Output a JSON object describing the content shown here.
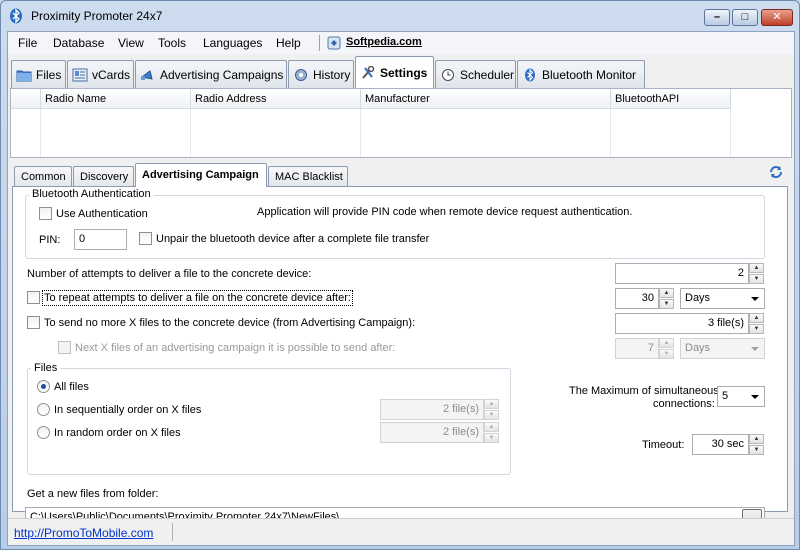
{
  "window": {
    "title": "Proximity Promoter 24x7",
    "controls": {
      "minimize": "–",
      "maximize": "□",
      "close": "✕"
    }
  },
  "menu": {
    "items": [
      "File",
      "Database",
      "View",
      "Tools",
      "Languages",
      "Help"
    ],
    "softpedia_link": "Softpedia.com"
  },
  "main_tabs": [
    {
      "label": "Files",
      "icon": "folder-icon"
    },
    {
      "label": "vCards",
      "icon": "vcard-icon"
    },
    {
      "label": "Advertising Campaigns",
      "icon": "campaign-icon"
    },
    {
      "label": "History",
      "icon": "history-gear-icon"
    },
    {
      "label": "Settings",
      "icon": "settings-tools-icon",
      "active": true
    },
    {
      "label": "Scheduler",
      "icon": "clock-icon"
    },
    {
      "label": "Bluetooth Monitor",
      "icon": "bluetooth-icon"
    }
  ],
  "radio_grid": {
    "columns": [
      "Radio Name",
      "Radio Address",
      "Manufacturer",
      "BluetoothAPI"
    ]
  },
  "sub_tabs": [
    "Common",
    "Discovery",
    "Advertising Campaign",
    "MAC Blacklist"
  ],
  "active_sub_tab": "Advertising Campaign",
  "auth": {
    "group_title": "Bluetooth Authentication",
    "use_auth_label": "Use Authentication",
    "use_auth_checked": false,
    "info": "Application will provide PIN code when remote device request authentication.",
    "pin_label": "PIN:",
    "pin_value": "0",
    "unpair_label": "Unpair the bluetooth device after a complete file transfer",
    "unpair_checked": false
  },
  "attempts": {
    "label": "Number of attempts to deliver a file to the concrete device:",
    "value": "2"
  },
  "repeat": {
    "label": "To repeat attempts to deliver a file on the concrete device after:",
    "checked": false,
    "value": "30",
    "unit": "Days"
  },
  "max_files": {
    "label": "To send no more X files to the concrete device (from Advertising Campaign):",
    "checked": false,
    "value": "3 file(s)"
  },
  "next_files": {
    "label": "Next X files of an advertising campaign it is possible to send after:",
    "checked": false,
    "value": "7",
    "unit": "Days"
  },
  "files_group": {
    "title": "Files",
    "options": [
      {
        "label": "All files",
        "selected": true
      },
      {
        "label": "In sequentially order on X files",
        "selected": false,
        "value": "2 file(s)"
      },
      {
        "label": "In random order on X files",
        "selected": false,
        "value": "2 file(s)"
      }
    ]
  },
  "connections": {
    "label_line1": "The Maximum of simultaneous",
    "label_line2": "connections:",
    "value": "5"
  },
  "timeout": {
    "label": "Timeout:",
    "value": "30 sec"
  },
  "folder": {
    "label": "Get a new files from folder:",
    "path": "C:\\Users\\Public\\Documents\\Proximity Promoter 24x7\\NewFiles\\",
    "browse_label": "..."
  },
  "status": {
    "link": "http://PromoToMobile.com"
  },
  "colors": {
    "accent": "#1d4f9b",
    "link": "#0033cc",
    "title_bar": "#c7d7ea"
  }
}
